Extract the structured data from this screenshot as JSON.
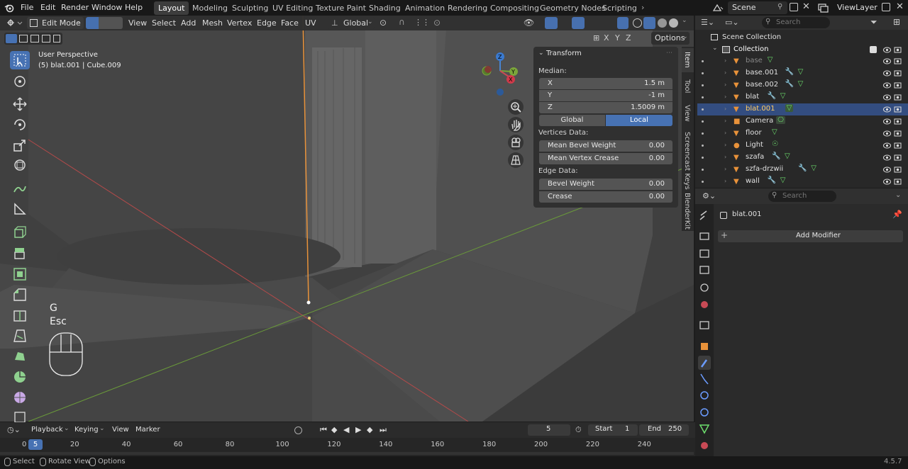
{
  "menubar": {
    "items": [
      "File",
      "Edit",
      "Render",
      "Window",
      "Help"
    ],
    "workspaces": [
      "Layout",
      "Modeling",
      "Sculpting",
      "UV Editing",
      "Texture Paint",
      "Shading",
      "Animation",
      "Rendering",
      "Compositing",
      "Geometry Nodes",
      "Scripting"
    ],
    "active_workspace": "Layout",
    "scene": "Scene",
    "view_layer": "ViewLayer"
  },
  "viewport_header": {
    "mode": "Edit Mode",
    "menus": [
      "View",
      "Select",
      "Add",
      "Mesh",
      "Vertex",
      "Edge",
      "Face",
      "UV"
    ],
    "orientation": "Global",
    "axes": [
      "X",
      "Y",
      "Z"
    ],
    "options_label": "Options"
  },
  "viewport": {
    "perspective": "User Perspective",
    "object_info": "(5) blat.001 | Cube.009",
    "keys": [
      "G",
      "Esc"
    ]
  },
  "side_tabs": [
    "Item",
    "Tool",
    "View",
    "Screencast Keys",
    "BlenderKit"
  ],
  "transform_panel": {
    "title": "Transform",
    "median_label": "Median:",
    "x_label": "X",
    "x_value": "1.5 m",
    "y_label": "Y",
    "y_value": "-1 m",
    "z_label": "Z",
    "z_value": "1.5009 m",
    "global_label": "Global",
    "local_label": "Local",
    "vertices_data_label": "Vertices Data:",
    "mean_bevel_label": "Mean Bevel Weight",
    "mean_bevel_value": "0.00",
    "mean_crease_label": "Mean Vertex Crease",
    "mean_crease_value": "0.00",
    "edge_data_label": "Edge Data:",
    "bevel_weight_label": "Bevel Weight",
    "bevel_weight_value": "0.00",
    "crease_label": "Crease",
    "crease_value": "0.00"
  },
  "outliner": {
    "search_placeholder": "Search",
    "scene_collection": "Scene Collection",
    "collection": "Collection",
    "objects": [
      "base",
      "base.001",
      "base.002",
      "blat",
      "blat.001",
      "Camera",
      "floor",
      "Light",
      "szafa",
      "szfa-drzwii",
      "wall"
    ],
    "selected": "blat.001"
  },
  "properties": {
    "search_placeholder": "Search",
    "object_name": "blat.001",
    "add_modifier": "Add Modifier"
  },
  "timeline": {
    "menus": [
      "Playback",
      "Keying",
      "View",
      "Marker"
    ],
    "current_frame": "5",
    "start_label": "Start",
    "start_value": "1",
    "end_label": "End",
    "end_value": "250",
    "ticks": [
      "0",
      "20",
      "40",
      "60",
      "80",
      "100",
      "120",
      "140",
      "160",
      "180",
      "200",
      "220",
      "240"
    ],
    "playhead_label": "5"
  },
  "statusbar": {
    "select": "Select",
    "rotate_view": "Rotate View",
    "options": "Options",
    "version": "4.5.7"
  },
  "colors": {
    "selection_blue": "#4772b3",
    "object_orange": "#e8923a",
    "mesh_green": "#6dde6d",
    "modifier_blue": "#6b9cff"
  }
}
